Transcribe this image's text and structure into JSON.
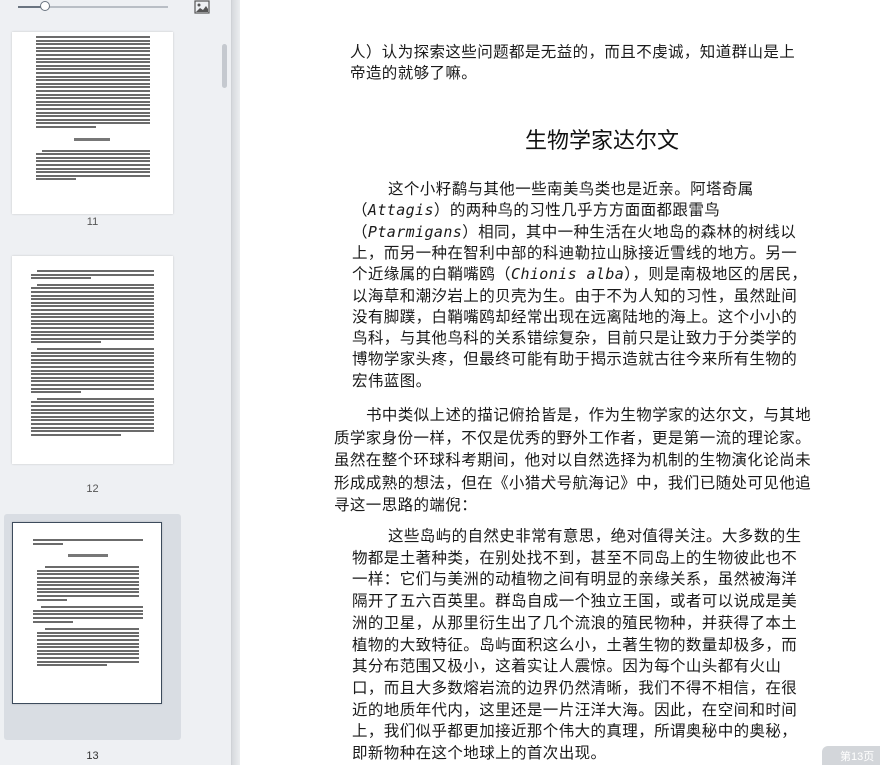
{
  "sidebar": {
    "zoom_level": 0.18,
    "pages": [
      {
        "number": "11",
        "selected": false
      },
      {
        "number": "12",
        "selected": false
      },
      {
        "number": "13",
        "selected": true
      }
    ]
  },
  "document": {
    "top_lines": [
      "人）认为探索这些问题都是无益的，而且不虔诚，知道群山是上",
      "帝造的就够了嘛。"
    ],
    "heading": "生物学家达尔文",
    "quote1": [
      [
        "这个小籽鹬与其他一些南美鸟类也是近亲。阿塔奇属"
      ],
      [
        "（",
        {
          "i": "Attagis"
        },
        "）的两种鸟的习性几乎方方面面都跟雷鸟"
      ],
      [
        "（",
        {
          "i": "Ptarmigans"
        },
        "）相同，其中一种生活在火地岛的森林的树线以"
      ],
      [
        "上，而另一种在智利中部的科迪勒拉山脉接近雪线的地方。另一"
      ],
      [
        "个近缘属的白鞘嘴鸥（",
        {
          "i": "Chionis alba"
        },
        "），则是南极地区的居民，"
      ],
      [
        "以海草和潮汐岩上的贝壳为生。由于不为人知的习性，虽然趾间"
      ],
      [
        "没有脚蹼，白鞘嘴鸥却经常出现在远离陆地的海上。这个小小的"
      ],
      [
        "鸟科，与其他鸟科的关系错综复杂，目前只是让致力于分类学的"
      ],
      [
        "博物学家头疼，但最终可能有助于揭示造就古往今来所有生物的"
      ],
      [
        "宏伟蓝图。"
      ]
    ],
    "body_para": [
      "书中类似上述的描记俯拾皆是，作为生物学家的达尔文，与其地",
      "质学家身份一样，不仅是优秀的野外工作者，更是第一流的理论家。",
      "虽然在整个环球科考期间，他对以自然选择为机制的生物演化论尚未",
      "形成成熟的想法，但在《小猎犬号航海记》中，我们已随处可见他追",
      "寻这一思路的端倪："
    ],
    "quote2": [
      "这些岛屿的自然史非常有意思，绝对值得关注。大多数的生",
      "物都是土著种类，在别处找不到，甚至不同岛上的生物彼此也不",
      "一样：它们与美洲的动植物之间有明显的亲缘关系，虽然被海洋",
      "隔开了五六百英里。群岛自成一个独立王国，或者可以说成是美",
      "洲的卫星，从那里衍生出了几个流浪的殖民物种，并获得了本土",
      "植物的大致特征。岛屿面积这么小，土著生物的数量却极多，而",
      "其分布范围又极小，这着实让人震惊。因为每个山头都有火山",
      "口，而且大多数熔岩流的边界仍然清晰，我们不得不相信，在很",
      "近的地质年代内，这里还是一片汪洋大海。因此，在空间和时间",
      "上，我们似乎都更加接近那个伟大的真理，所谓奥秘中的奥秘，",
      "即新物种在这个地球上的首次出现。"
    ],
    "page_badge": "第13页"
  }
}
